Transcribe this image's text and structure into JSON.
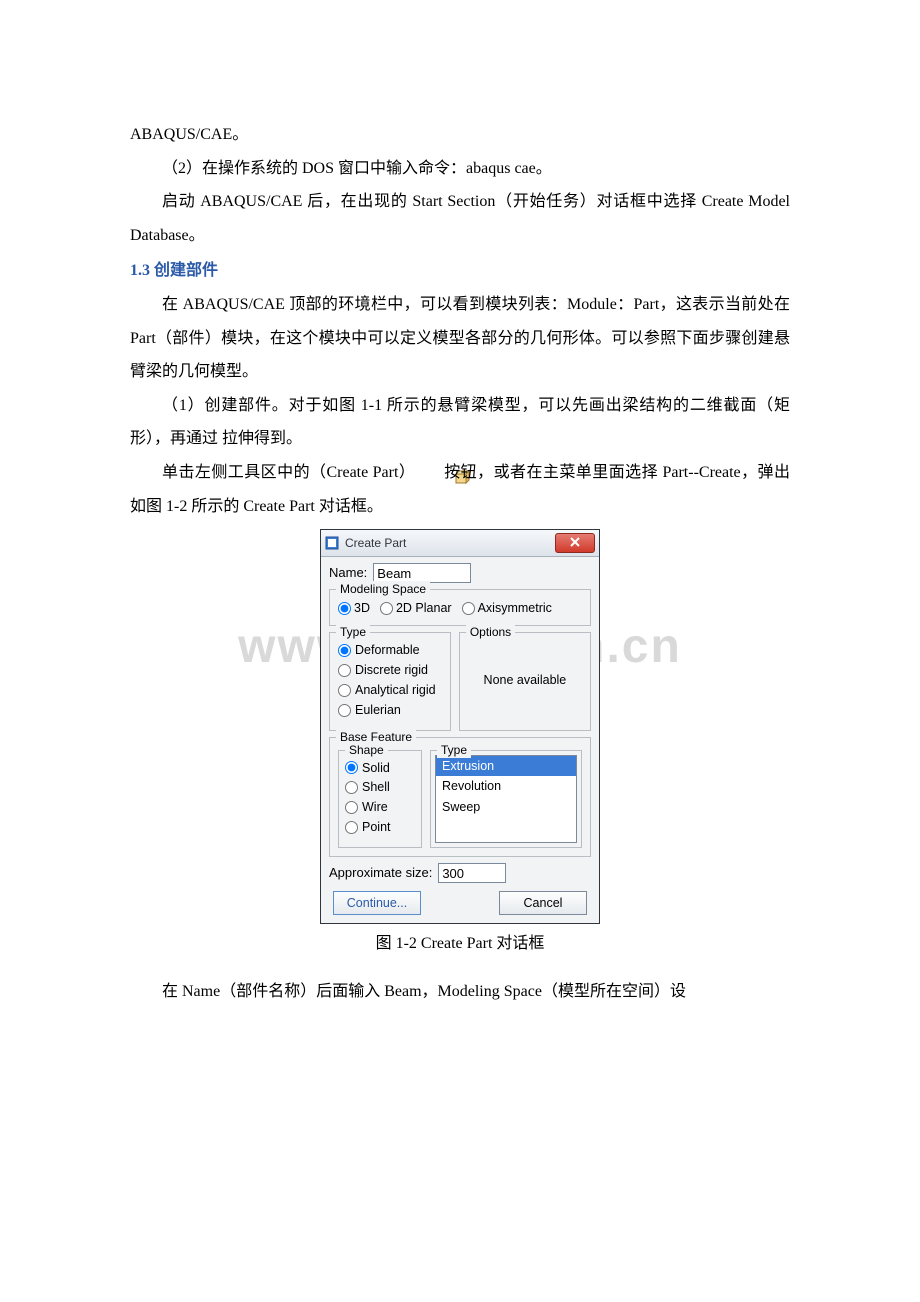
{
  "text": {
    "line1": "ABAQUS/CAE。",
    "para2": "（2）在操作系统的 DOS 窗口中输入命令：abaqus cae。",
    "para3": "启动 ABAQUS/CAE 后，在出现的 Start Section（开始任务）对话框中选择 Create Model Database。",
    "heading13": "1.3 创建部件",
    "para4": "在 ABAQUS/CAE 顶部的环境栏中，可以看到模块列表：Module：Part，这表示当前处在 Part（部件）模块，在这个模块中可以定义模型各部分的几何形体。可以参照下面步骤创建悬臂梁的几何模型。",
    "para5": "（1）创建部件。对于如图 1-1 所示的悬臂梁模型，可以先画出梁结构的二维截面（矩形），再通过 拉伸得到。",
    "para6a": "单击左侧工具区中的（Create Part）",
    "para6b": "按钮，或者在主菜单里面选择 Part--Create，弹出如图 1-2 所示的 Create Part 对话框。",
    "caption": "图 1-2 Create Part 对话框",
    "lastpara": "在 Name（部件名称）后面输入 Beam，Modeling Space（模型所在空间）设",
    "watermark": "www.zixin.com.cn"
  },
  "dialog": {
    "title": "Create Part",
    "name_label": "Name:",
    "name_value": "Beam",
    "modeling_space_label": "Modeling Space",
    "ms": {
      "opt3d": "3D",
      "opt2d": "2D Planar",
      "optax": "Axisymmetric"
    },
    "type_label": "Type",
    "options_label": "Options",
    "type": {
      "deformable": "Deformable",
      "discrete": "Discrete rigid",
      "analytical": "Analytical rigid",
      "eulerian": "Eulerian"
    },
    "none_available": "None available",
    "base_feature_label": "Base Feature",
    "shape_label": "Shape",
    "shape": {
      "solid": "Solid",
      "shell": "Shell",
      "wire": "Wire",
      "point": "Point"
    },
    "bf_type_label": "Type",
    "bf_types": [
      "Extrusion",
      "Revolution",
      "Sweep"
    ],
    "approx_label": "Approximate size:",
    "approx_value": "300",
    "continue": "Continue...",
    "cancel": "Cancel"
  }
}
